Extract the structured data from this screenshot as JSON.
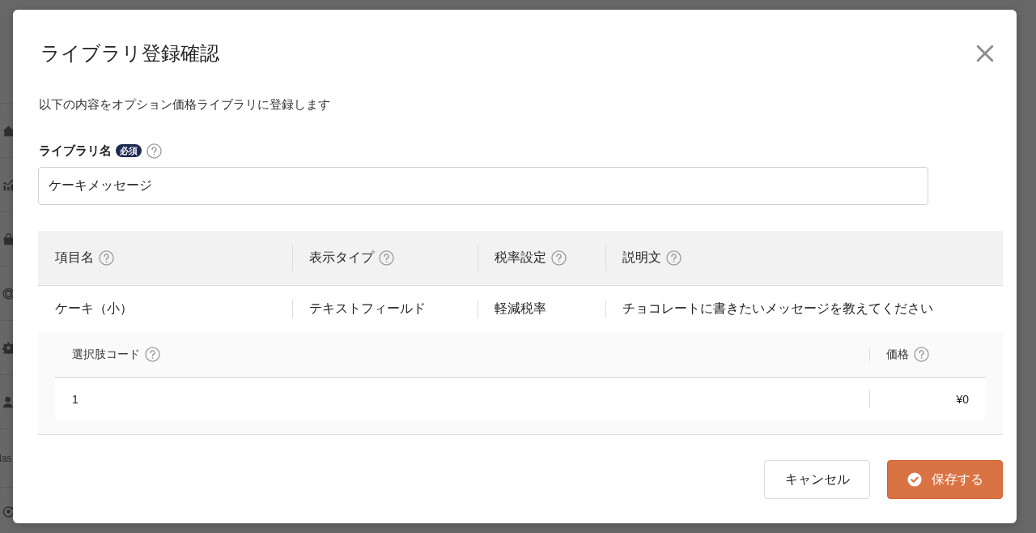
{
  "sidebar": {
    "label": "las"
  },
  "dialog": {
    "title": "ライブラリ登録確認",
    "description": "以下の内容をオプション価格ライブラリに登録します",
    "field": {
      "label": "ライブラリ名",
      "required_badge": "必須",
      "value": "ケーキメッセージ"
    },
    "table": {
      "columns": [
        "項目名",
        "表示タイプ",
        "税率設定",
        "説明文"
      ],
      "rows": [
        {
          "cells": [
            "ケーキ（小）",
            "テキストフィールド",
            "軽減税率",
            "チョコレートに書きたいメッセージを教えてください"
          ],
          "options": {
            "columns": [
              "選択肢コード",
              "価格"
            ],
            "rows": [
              [
                "1",
                "¥0"
              ]
            ]
          }
        }
      ]
    },
    "buttons": [
      {
        "label": "キャンセル",
        "kind": "secondary"
      },
      {
        "label": "保存する",
        "kind": "primary"
      }
    ]
  }
}
